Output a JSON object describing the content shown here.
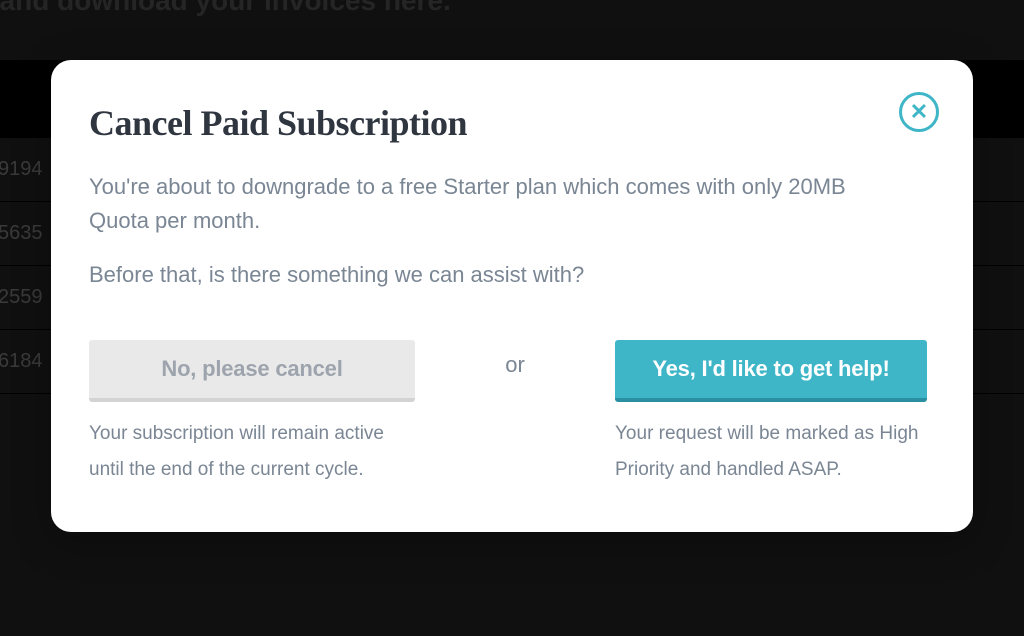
{
  "background": {
    "heading_fragment": "w and download your invoices here.",
    "rows": [
      "9194",
      "5635",
      "2559",
      "6184"
    ]
  },
  "modal": {
    "title": "Cancel Paid Subscription",
    "description_line1": "You're about to downgrade to a free Starter plan which comes with only 20MB Quota per month.",
    "description_line2": "Before that, is there something we can assist with?",
    "separator": "or",
    "cancel": {
      "label": "No, please cancel",
      "note": "Your subscription will remain active until the end of the current cycle."
    },
    "help": {
      "label": "Yes, I'd like to get help!",
      "note": "Your request will be marked as High Priority and handled ASAP."
    }
  }
}
